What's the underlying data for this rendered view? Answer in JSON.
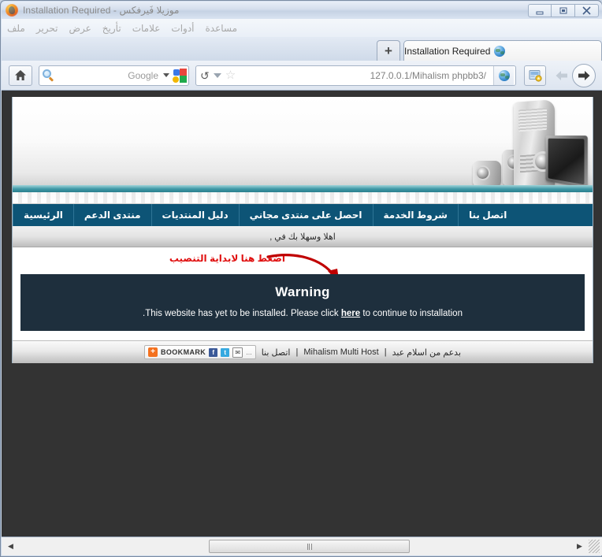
{
  "window": {
    "title": "Installation Required - موزيلا فَيرفكس",
    "minimize_label": "تصغير",
    "restore_label": "استعادة",
    "close_label": "إغلاق"
  },
  "menubar": {
    "items": [
      {
        "label": "ملف"
      },
      {
        "label": "تحرير"
      },
      {
        "label": "عرض"
      },
      {
        "label": "تأريخ"
      },
      {
        "label": "علامات"
      },
      {
        "label": "أدوات"
      },
      {
        "label": "مساعدة"
      }
    ]
  },
  "tabs": {
    "active_tab_title": "Installation Required",
    "new_tab_label": "+"
  },
  "toolbar": {
    "home_icon": "home-icon",
    "search_engine": "Google",
    "search_icon": "magnifier-icon",
    "reload_glyph": "↺",
    "star_glyph": "☆",
    "url": "127.0.0.1/Mihalism phpbb3/",
    "url_host": "127.0.0.1",
    "url_path": "/Mihalism phpbb3/",
    "identity_icon": "globe-icon",
    "feed_icon": "page-star-icon",
    "back_label": "رجوع",
    "forward_label": "تقدم"
  },
  "page": {
    "nav": [
      {
        "label": "الرئيسية"
      },
      {
        "label": "منتدى الدعم"
      },
      {
        "label": "دليل المنتديات"
      },
      {
        "label": "احصل على منتدى مجاني"
      },
      {
        "label": "شروط الخدمة"
      },
      {
        "label": "اتصل بنا"
      }
    ],
    "welcome": "اهلا وسهلا بك في ,",
    "annotation": "اضغط هنا لابداية التنصيب",
    "warning": {
      "title": "Warning",
      "message_before": ".This website has yet to be installed. Please click",
      "link": "here",
      "message_after": "to continue to installation"
    },
    "footer": {
      "support": "بدعم من اسلام عبد",
      "sep1": "|",
      "host": "Mihalism Multi Host",
      "sep2": "|",
      "contact": "اتصل بنا",
      "bookmark_label": "BOOKMARK",
      "bookmark_plus": "+",
      "facebook": "f",
      "twitter": "t",
      "mail": "✉",
      "more": "..."
    }
  },
  "scrollbar": {
    "left_glyph": "◀",
    "right_glyph": "▶",
    "thumb_position_pct": 48
  },
  "colors": {
    "nav_blue": "#0d5476",
    "warning_bg": "#1e2f3d",
    "annotation_red": "#e01010",
    "viewport_bg": "#333333",
    "bookmark_orange": "#f4711f"
  }
}
